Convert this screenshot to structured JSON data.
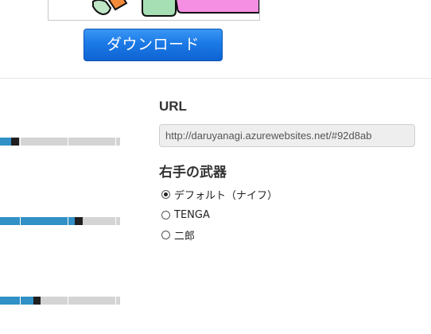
{
  "download_button": {
    "label": "ダウンロード"
  },
  "share": {
    "url_label": "URL",
    "url_value": "http://daruyanagi.azurewebsites.net/#92d8ab"
  },
  "weapon": {
    "label": "右手の武器",
    "options": [
      {
        "label": "デフォルト（ナイフ）",
        "checked": true
      },
      {
        "label": "TENGA",
        "checked": false
      },
      {
        "label": "二郎",
        "checked": false
      }
    ]
  },
  "stat_bars": [
    {
      "filled_fraction": 0.09,
      "marker_fraction": 0.16
    },
    {
      "filled_fraction": 0.62,
      "marker_fraction": 0.69
    },
    {
      "filled_fraction": 0.28,
      "marker_fraction": 0.34
    }
  ],
  "colors": {
    "accent_blue": "#3190c5",
    "marker": "#1f1f1f",
    "track": "#d4d4d4",
    "button_blue": "#1b79e6"
  }
}
